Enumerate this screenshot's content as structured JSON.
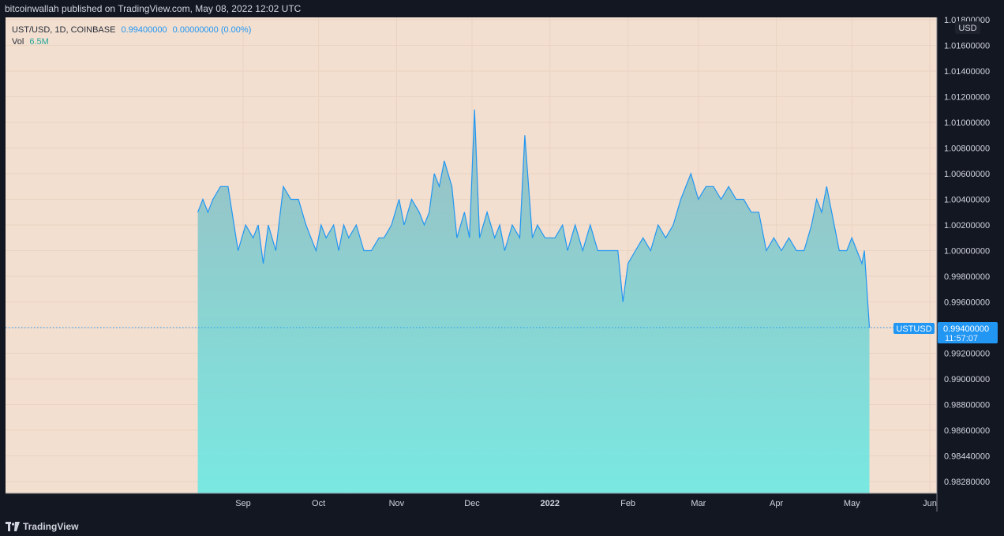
{
  "header": {
    "publish_text": "bitcoinwallah published on TradingView.com, May 08, 2022 12:02 UTC"
  },
  "footer": {
    "brand": "TradingView"
  },
  "legend": {
    "symbol": "UST/USD, 1D, COINBASE",
    "last": "0.99400000",
    "change": "0.00000000 (0.00%)",
    "vol_label": "Vol",
    "vol_value": "6.5M"
  },
  "colors": {
    "background": "#f2dfd0",
    "line": "#2196f3",
    "area_top": "#9dbdc2",
    "area_bottom": "#79e8e1",
    "vol_up": "#6fd5c2",
    "vol_down": "#d89a8e"
  },
  "price_label": {
    "tag": "USTUSD",
    "value": "0.99400000",
    "countdown": "11:57:07"
  },
  "chart_data": {
    "type": "area",
    "title": "UST/USD, 1D, COINBASE",
    "currency_label": "USD",
    "ylim": [
      0.9812,
      1.018
    ],
    "y_ticks": [
      "1.01800000",
      "1.01600000",
      "1.01400000",
      "1.01200000",
      "1.01000000",
      "1.00800000",
      "1.00600000",
      "1.00400000",
      "1.00200000",
      "1.00000000",
      "0.99800000",
      "0.99600000",
      "0.99400000",
      "0.99200000",
      "0.99000000",
      "0.98800000",
      "0.98600000",
      "0.98440000",
      "0.98280000"
    ],
    "x_ticks": [
      {
        "label": "Sep",
        "date": "2021-09-01"
      },
      {
        "label": "Oct",
        "date": "2021-10-01"
      },
      {
        "label": "Nov",
        "date": "2021-11-01"
      },
      {
        "label": "Dec",
        "date": "2021-12-01"
      },
      {
        "label": "2022",
        "date": "2022-01-01"
      },
      {
        "label": "Feb",
        "date": "2022-02-01"
      },
      {
        "label": "Mar",
        "date": "2022-03-01"
      },
      {
        "label": "Apr",
        "date": "2022-04-01"
      },
      {
        "label": "May",
        "date": "2022-05-01"
      },
      {
        "label": "Jun",
        "date": "2022-06-01"
      }
    ],
    "series": [
      {
        "values": [
          [
            "2021-08-14",
            1.003
          ],
          [
            "2021-08-16",
            1.004
          ],
          [
            "2021-08-18",
            1.003
          ],
          [
            "2021-08-20",
            1.004
          ],
          [
            "2021-08-23",
            1.005
          ],
          [
            "2021-08-26",
            1.005
          ],
          [
            "2021-08-30",
            1.0
          ],
          [
            "2021-09-02",
            1.002
          ],
          [
            "2021-09-05",
            1.001
          ],
          [
            "2021-09-07",
            1.002
          ],
          [
            "2021-09-09",
            0.999
          ],
          [
            "2021-09-11",
            1.002
          ],
          [
            "2021-09-14",
            1.0
          ],
          [
            "2021-09-17",
            1.005
          ],
          [
            "2021-09-20",
            1.004
          ],
          [
            "2021-09-23",
            1.004
          ],
          [
            "2021-09-26",
            1.002
          ],
          [
            "2021-09-28",
            1.001
          ],
          [
            "2021-09-30",
            1.0
          ],
          [
            "2021-10-02",
            1.002
          ],
          [
            "2021-10-04",
            1.001
          ],
          [
            "2021-10-07",
            1.002
          ],
          [
            "2021-10-09",
            1.0
          ],
          [
            "2021-10-11",
            1.002
          ],
          [
            "2021-10-13",
            1.001
          ],
          [
            "2021-10-16",
            1.002
          ],
          [
            "2021-10-19",
            1.0
          ],
          [
            "2021-10-22",
            1.0
          ],
          [
            "2021-10-25",
            1.001
          ],
          [
            "2021-10-27",
            1.001
          ],
          [
            "2021-10-30",
            1.002
          ],
          [
            "2021-11-02",
            1.004
          ],
          [
            "2021-11-04",
            1.002
          ],
          [
            "2021-11-07",
            1.004
          ],
          [
            "2021-11-10",
            1.003
          ],
          [
            "2021-11-12",
            1.002
          ],
          [
            "2021-11-14",
            1.003
          ],
          [
            "2021-11-16",
            1.006
          ],
          [
            "2021-11-18",
            1.005
          ],
          [
            "2021-11-20",
            1.007
          ],
          [
            "2021-11-23",
            1.005
          ],
          [
            "2021-11-25",
            1.001
          ],
          [
            "2021-11-28",
            1.003
          ],
          [
            "2021-11-30",
            1.001
          ],
          [
            "2021-12-02",
            1.011
          ],
          [
            "2021-12-04",
            1.001
          ],
          [
            "2021-12-07",
            1.003
          ],
          [
            "2021-12-10",
            1.001
          ],
          [
            "2021-12-12",
            1.002
          ],
          [
            "2021-12-14",
            1.0
          ],
          [
            "2021-12-17",
            1.002
          ],
          [
            "2021-12-20",
            1.001
          ],
          [
            "2021-12-22",
            1.009
          ],
          [
            "2021-12-25",
            1.001
          ],
          [
            "2021-12-27",
            1.002
          ],
          [
            "2021-12-30",
            1.001
          ],
          [
            "2022-01-03",
            1.001
          ],
          [
            "2022-01-06",
            1.002
          ],
          [
            "2022-01-08",
            1.0
          ],
          [
            "2022-01-11",
            1.002
          ],
          [
            "2022-01-14",
            1.0
          ],
          [
            "2022-01-17",
            1.002
          ],
          [
            "2022-01-20",
            1.0
          ],
          [
            "2022-01-24",
            1.0
          ],
          [
            "2022-01-28",
            1.0
          ],
          [
            "2022-01-30",
            0.996
          ],
          [
            "2022-02-01",
            0.999
          ],
          [
            "2022-02-04",
            1.0
          ],
          [
            "2022-02-07",
            1.001
          ],
          [
            "2022-02-10",
            1.0
          ],
          [
            "2022-02-13",
            1.002
          ],
          [
            "2022-02-16",
            1.001
          ],
          [
            "2022-02-19",
            1.002
          ],
          [
            "2022-02-22",
            1.004
          ],
          [
            "2022-02-26",
            1.006
          ],
          [
            "2022-03-01",
            1.004
          ],
          [
            "2022-03-04",
            1.005
          ],
          [
            "2022-03-07",
            1.005
          ],
          [
            "2022-03-10",
            1.004
          ],
          [
            "2022-03-13",
            1.005
          ],
          [
            "2022-03-16",
            1.004
          ],
          [
            "2022-03-19",
            1.004
          ],
          [
            "2022-03-22",
            1.003
          ],
          [
            "2022-03-25",
            1.003
          ],
          [
            "2022-03-28",
            1.0
          ],
          [
            "2022-03-31",
            1.001
          ],
          [
            "2022-04-03",
            1.0
          ],
          [
            "2022-04-06",
            1.001
          ],
          [
            "2022-04-09",
            1.0
          ],
          [
            "2022-04-12",
            1.0
          ],
          [
            "2022-04-15",
            1.002
          ],
          [
            "2022-04-17",
            1.004
          ],
          [
            "2022-04-19",
            1.003
          ],
          [
            "2022-04-21",
            1.005
          ],
          [
            "2022-04-23",
            1.003
          ],
          [
            "2022-04-26",
            1.0
          ],
          [
            "2022-04-29",
            1.0
          ],
          [
            "2022-05-01",
            1.001
          ],
          [
            "2022-05-03",
            1.0
          ],
          [
            "2022-05-05",
            0.999
          ],
          [
            "2022-05-06",
            1.0
          ],
          [
            "2022-05-08",
            0.994
          ]
        ]
      }
    ]
  }
}
